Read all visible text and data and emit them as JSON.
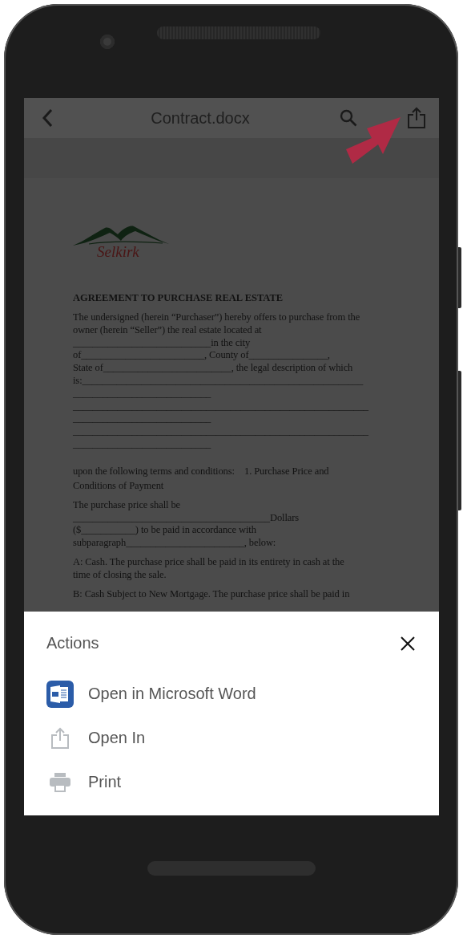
{
  "toolbar": {
    "title": "Contract.docx"
  },
  "document": {
    "logo_text": "Selkirk",
    "heading": "AGREEMENT TO PURCHASE REAL ESTATE",
    "paragraphs": [
      "The undersigned (herein “Purchaser”) hereby offers to purchase from the\nowner (herein “Seller”) the real estate located at\n____________________________in the city\nof_________________________, County of________________,\nState of__________________________, the legal description of which\nis:_________________________________________________________\n____________________________\n____________________________________________________________\n____________________________\n____________________________________________________________\n____________________________",
      "upon the following terms and conditions:    1. Purchase Price and\nConditions of Payment",
      "The purchase price shall be\n________________________________________Dollars\n($___________) to be paid in accordance with\nsubparagraph________________________, below:",
      "A: Cash. The purchase price shall be paid in its entirety in cash at the\ntime of closing the sale.",
      "B: Cash Subject to New Mortgage. The purchase price shall be paid in"
    ]
  },
  "actions": {
    "title": "Actions",
    "items": [
      {
        "label": "Open in Microsoft Word",
        "kind": "word"
      },
      {
        "label": "Open In",
        "kind": "share"
      },
      {
        "label": "Print",
        "kind": "print"
      }
    ]
  }
}
